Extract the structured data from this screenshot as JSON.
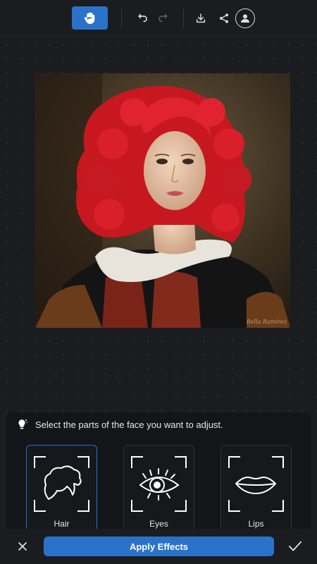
{
  "toolbar": {
    "icons": [
      "hand-icon",
      "undo-icon",
      "redo-icon",
      "download-icon",
      "share-icon",
      "profile-icon"
    ],
    "active_tool": "hand"
  },
  "artwork": {
    "description_icon": "portrait-image",
    "signature": "Bella Ramírez"
  },
  "panel": {
    "hint_icon": "lightbulb-icon",
    "hint": "Select the parts of the face you want to adjust.",
    "parts": [
      {
        "label": "Hair",
        "icon": "hair-icon",
        "selected": true
      },
      {
        "label": "Eyes",
        "icon": "eye-icon",
        "selected": false
      },
      {
        "label": "Lips",
        "icon": "lips-icon",
        "selected": false
      }
    ]
  },
  "footer": {
    "apply_label": "Apply Effects",
    "close_icon": "close-icon",
    "confirm_icon": "checkmark-icon"
  },
  "colors": {
    "accent": "#2a72c9",
    "background": "#1b1c1f",
    "panel": "#141518",
    "hair": "#d81f2a"
  }
}
